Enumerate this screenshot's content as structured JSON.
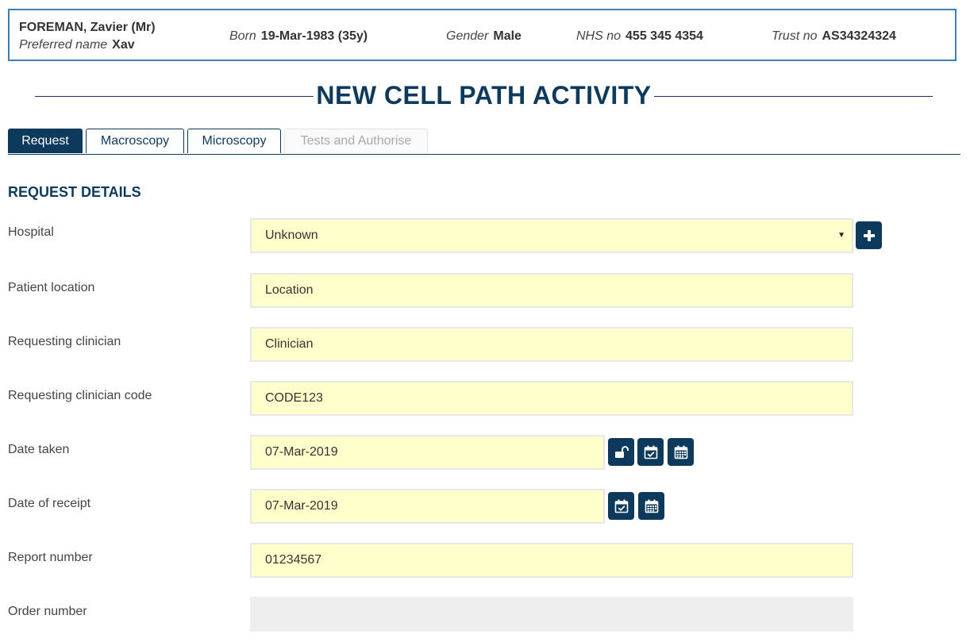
{
  "patient": {
    "name": "FOREMAN, Zavier (Mr)",
    "preferred_label": "Preferred name",
    "preferred_value": "Xav",
    "born_label": "Born",
    "born_value": "19-Mar-1983 (35y)",
    "gender_label": "Gender",
    "gender_value": "Male",
    "nhs_label": "NHS no",
    "nhs_value": "455 345 4354",
    "trust_label": "Trust no",
    "trust_value": "AS34324324"
  },
  "page_title": "NEW CELL PATH ACTIVITY",
  "tabs": [
    {
      "label": "Request",
      "state": "active"
    },
    {
      "label": "Macroscopy",
      "state": "normal"
    },
    {
      "label": "Microscopy",
      "state": "normal"
    },
    {
      "label": "Tests and Authorise",
      "state": "disabled"
    }
  ],
  "section_heading": "REQUEST DETAILS",
  "form": {
    "hospital": {
      "label": "Hospital",
      "value": "Unknown"
    },
    "patient_location": {
      "label": "Patient location",
      "value": "Location"
    },
    "requesting_clinician": {
      "label": "Requesting clinician",
      "value": "Clinician"
    },
    "requesting_clinician_code": {
      "label": "Requesting clinician code",
      "value": "CODE123"
    },
    "date_taken": {
      "label": "Date taken",
      "value": "07-Mar-2019"
    },
    "date_of_receipt": {
      "label": "Date of receipt",
      "value": "07-Mar-2019"
    },
    "report_number": {
      "label": "Report number",
      "value": "01234567"
    },
    "order_number": {
      "label": "Order number",
      "value": ""
    }
  },
  "icons": {
    "add": "plus-icon",
    "unlock": "unlock-icon",
    "today": "calendar-check-icon",
    "calendar": "calendar-icon"
  },
  "colors": {
    "primary": "#0d3a5c",
    "banner_border": "#3a7fb8",
    "input_bg": "#ffffcc",
    "disabled_bg": "#eeeeee"
  }
}
